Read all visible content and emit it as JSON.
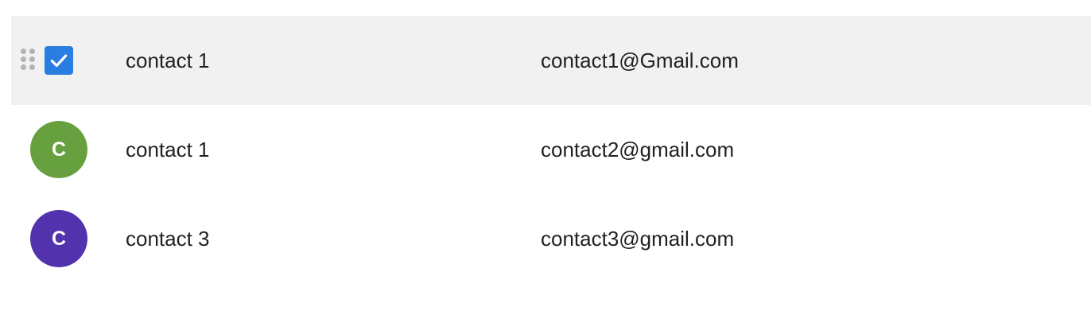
{
  "contacts": [
    {
      "name": "contact 1",
      "email": "contact1@Gmail.com",
      "selected": true,
      "icon": "drag-handle-icon"
    },
    {
      "name": "contact 1",
      "email": "contact2@gmail.com",
      "avatar_letter": "C",
      "avatar_color": "#67a03f",
      "selected": false
    },
    {
      "name": "contact 3",
      "email": "contact3@gmail.com",
      "avatar_letter": "C",
      "avatar_color": "#5232ad",
      "selected": false
    }
  ],
  "colors": {
    "selected_row_bg": "#f1f1f1",
    "checkbox_accent": "#2a7de1",
    "text": "#202124"
  }
}
